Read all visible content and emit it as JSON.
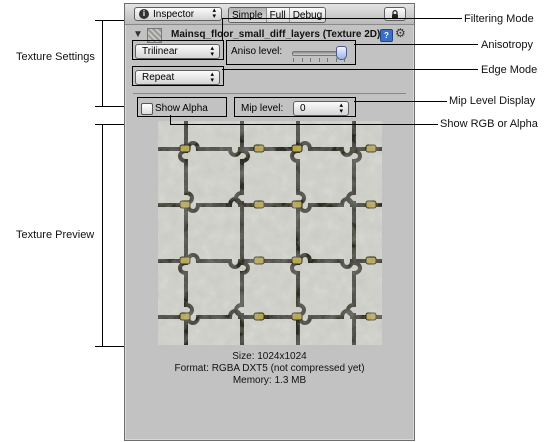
{
  "callouts": {
    "filtering_mode": "Filtering Mode",
    "anisotropy": "Anisotropy",
    "edge_mode": "Edge Mode",
    "mip_level_display": "Mip Level Display",
    "show_rgb_alpha": "Show RGB or Alpha",
    "texture_settings": "Texture Settings",
    "texture_preview": "Texture Preview"
  },
  "toolbar": {
    "inspector_label": "Inspector",
    "modes": [
      "Simple",
      "Full",
      "Debug"
    ],
    "active_mode": "Simple"
  },
  "header": {
    "title": "Mainsq_floor_small_diff_layers (Texture 2D)"
  },
  "settings": {
    "filter_value": "Trilinear",
    "aniso_label": "Aniso level:",
    "aniso_fraction": 0.92,
    "wrap_value": "Repeat"
  },
  "preview_controls": {
    "show_alpha_label": "Show Alpha",
    "show_alpha_checked": false,
    "mip_label": "Mip level:",
    "mip_value": "0"
  },
  "info": {
    "size": "Size: 1024x1024",
    "format": "Format: RGBA DXT5 (not compressed yet)",
    "memory": "Memory: 1.3 MB"
  },
  "colors": {
    "panel_bg": "#c2c2c2",
    "stone_light": "#d7d7d2",
    "stone_dark": "#6d6d66",
    "marker_gold": "#b7a763"
  }
}
